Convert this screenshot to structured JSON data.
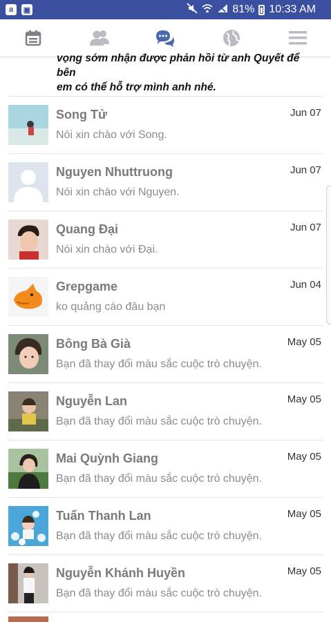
{
  "status_bar": {
    "battery": "81%",
    "time": "10:33 AM"
  },
  "nav": {
    "tabs": [
      {
        "icon": "calendar-icon"
      },
      {
        "icon": "friends-icon"
      },
      {
        "icon": "messages-icon",
        "active": true
      },
      {
        "icon": "globe-icon"
      },
      {
        "icon": "menu-icon"
      }
    ]
  },
  "snippet": {
    "line2": "vọng sớm nhận được phản hồi từ anh Quyết để bên",
    "line3": "em có thể hỗ trợ mình anh nhé."
  },
  "conversations": [
    {
      "name": "Song Tử",
      "preview": "Nói xin chào với Song.",
      "date": "Jun 07"
    },
    {
      "name": "Nguyen Nhuttruong",
      "preview": "Nói xin chào với Nguyen.",
      "date": "Jun 07"
    },
    {
      "name": "Quang Đại",
      "preview": "Nói xin chào với Đại.",
      "date": "Jun 07"
    },
    {
      "name": "Grepgame",
      "preview": "ko quảng cáo đâu bạn",
      "date": "Jun 04"
    },
    {
      "name": "Bông Bà Già",
      "preview": "Bạn đã thay đổi màu sắc cuộc trò chuyện.",
      "date": "May 05"
    },
    {
      "name": "Nguyễn Lan",
      "preview": "Bạn đã thay đổi màu sắc cuộc trò chuyện.",
      "date": "May 05"
    },
    {
      "name": "Mai Quỳnh Giang",
      "preview": "Bạn đã thay đổi màu sắc cuộc trò chuyện.",
      "date": "May 05"
    },
    {
      "name": "Tuấn Thanh Lan",
      "preview": "Bạn đã thay đổi màu sắc cuộc trò chuyện.",
      "date": "May 05"
    },
    {
      "name": "Nguyễn Khánh Huyền",
      "preview": "Bạn đã thay đổi màu sắc cuộc trò chuyện.",
      "date": "May 05"
    }
  ],
  "colors": {
    "status_bar": "#3b4fa0",
    "nav_active": "#4a67b0",
    "nav_inactive": "#b9bcc2"
  }
}
